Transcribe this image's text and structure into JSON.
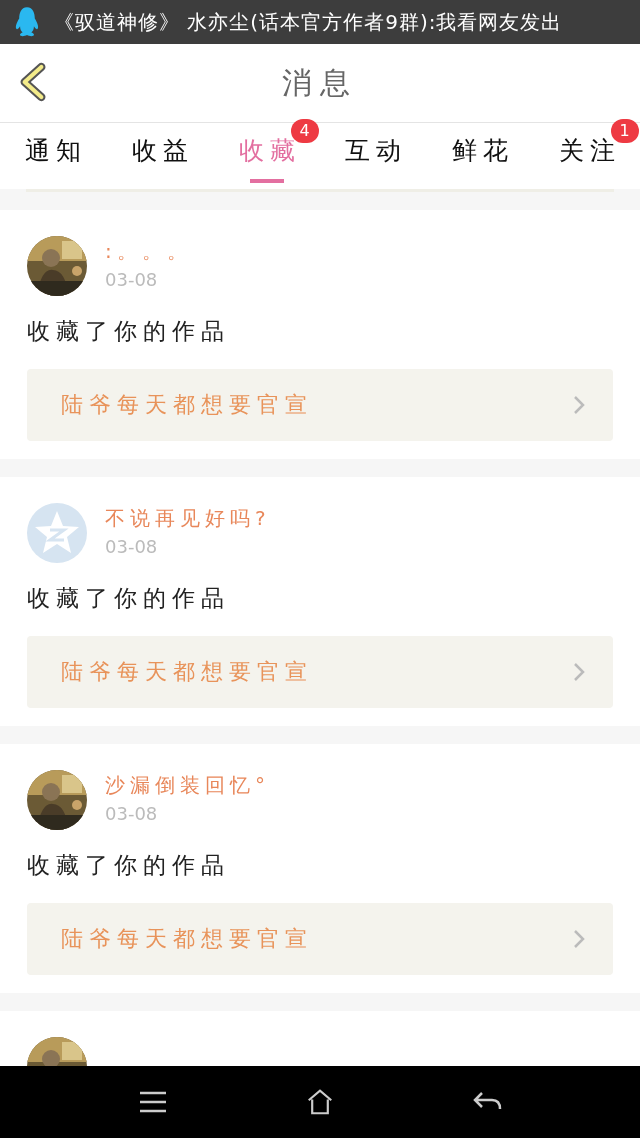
{
  "status_bar": {
    "notification_text": "《驭道神修》 水亦尘(话本官方作者9群):我看网友发出"
  },
  "header": {
    "title": "消息"
  },
  "tabs": [
    {
      "label": "通知",
      "selected": false
    },
    {
      "label": "收益",
      "selected": false
    },
    {
      "label": "收藏",
      "selected": true,
      "badge": "4"
    },
    {
      "label": "互动",
      "selected": false
    },
    {
      "label": "鲜花",
      "selected": false
    },
    {
      "label": "关注",
      "selected": false,
      "badge": "1"
    }
  ],
  "messages": [
    {
      "avatar": {
        "kind": "picture"
      },
      "name": ":。。。",
      "date": "03-08",
      "action": "收藏了你的作品",
      "work_title": "陆爷每天都想要官宣"
    },
    {
      "avatar": {
        "kind": "default"
      },
      "name": "不说再见好吗?",
      "date": "03-08",
      "action": "收藏了你的作品",
      "work_title": "陆爷每天都想要官宣"
    },
    {
      "avatar": {
        "kind": "picture"
      },
      "name": "沙漏倒装回忆°",
      "date": "03-08",
      "action": "收藏了你的作品",
      "work_title": "陆爷每天都想要官宣"
    },
    {
      "avatar": {
        "kind": "picture"
      }
    }
  ]
}
